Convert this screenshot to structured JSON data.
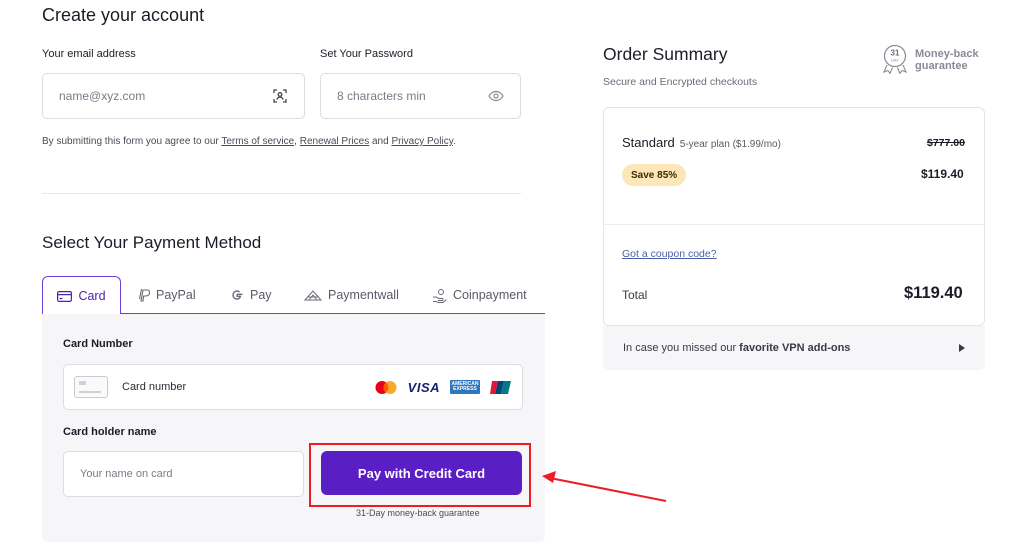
{
  "account": {
    "title": "Create your account",
    "email_label": "Your email address",
    "email_placeholder": "name@xyz.com",
    "password_label": "Set Your Password",
    "password_placeholder": "8 characters min",
    "terms": {
      "prefix": "By submitting this form you agree to our ",
      "tos": "Terms of service",
      "sep1": ", ",
      "renewal": "Renewal Prices",
      "sep2": " and ",
      "privacy": "Privacy Policy",
      "suffix": "."
    }
  },
  "payment": {
    "title": "Select Your Payment Method",
    "tabs": [
      {
        "label": "Card",
        "active": true
      },
      {
        "label": "PayPal"
      },
      {
        "label": "Pay"
      },
      {
        "label": "Paymentwall"
      },
      {
        "label": "Coinpayment"
      }
    ],
    "card_number_label": "Card Number",
    "card_number_placeholder": "Card number",
    "brands": {
      "visa": "VISA",
      "amex_top": "AMERICAN",
      "amex_bottom": "EXPRESS"
    },
    "holder_label": "Card holder name",
    "holder_placeholder": "Your name on card",
    "pay_button": "Pay with Credit Card",
    "guarantee": "31-Day money-back guarantee"
  },
  "summary": {
    "title": "Order Summary",
    "subtitle": "Secure and Encrypted checkouts",
    "badge_days": "31",
    "badge_unit": "DAY",
    "money_back_line1": "Money-back",
    "money_back_line2": "guarantee",
    "plan_name": "Standard",
    "plan_detail": "5-year plan ($1.99/mo)",
    "old_price": "$777.00",
    "save_badge": "Save 85%",
    "price": "$119.40",
    "coupon": "Got a coupon code?",
    "total_label": "Total",
    "total_value": "$119.40",
    "addons_prefix": "In case you missed our ",
    "addons_bold": "favorite VPN add-ons"
  },
  "colors": {
    "accent": "#5a1fc4",
    "highlight": "#ee1c25",
    "save_badge_bg": "#fde7b8"
  }
}
